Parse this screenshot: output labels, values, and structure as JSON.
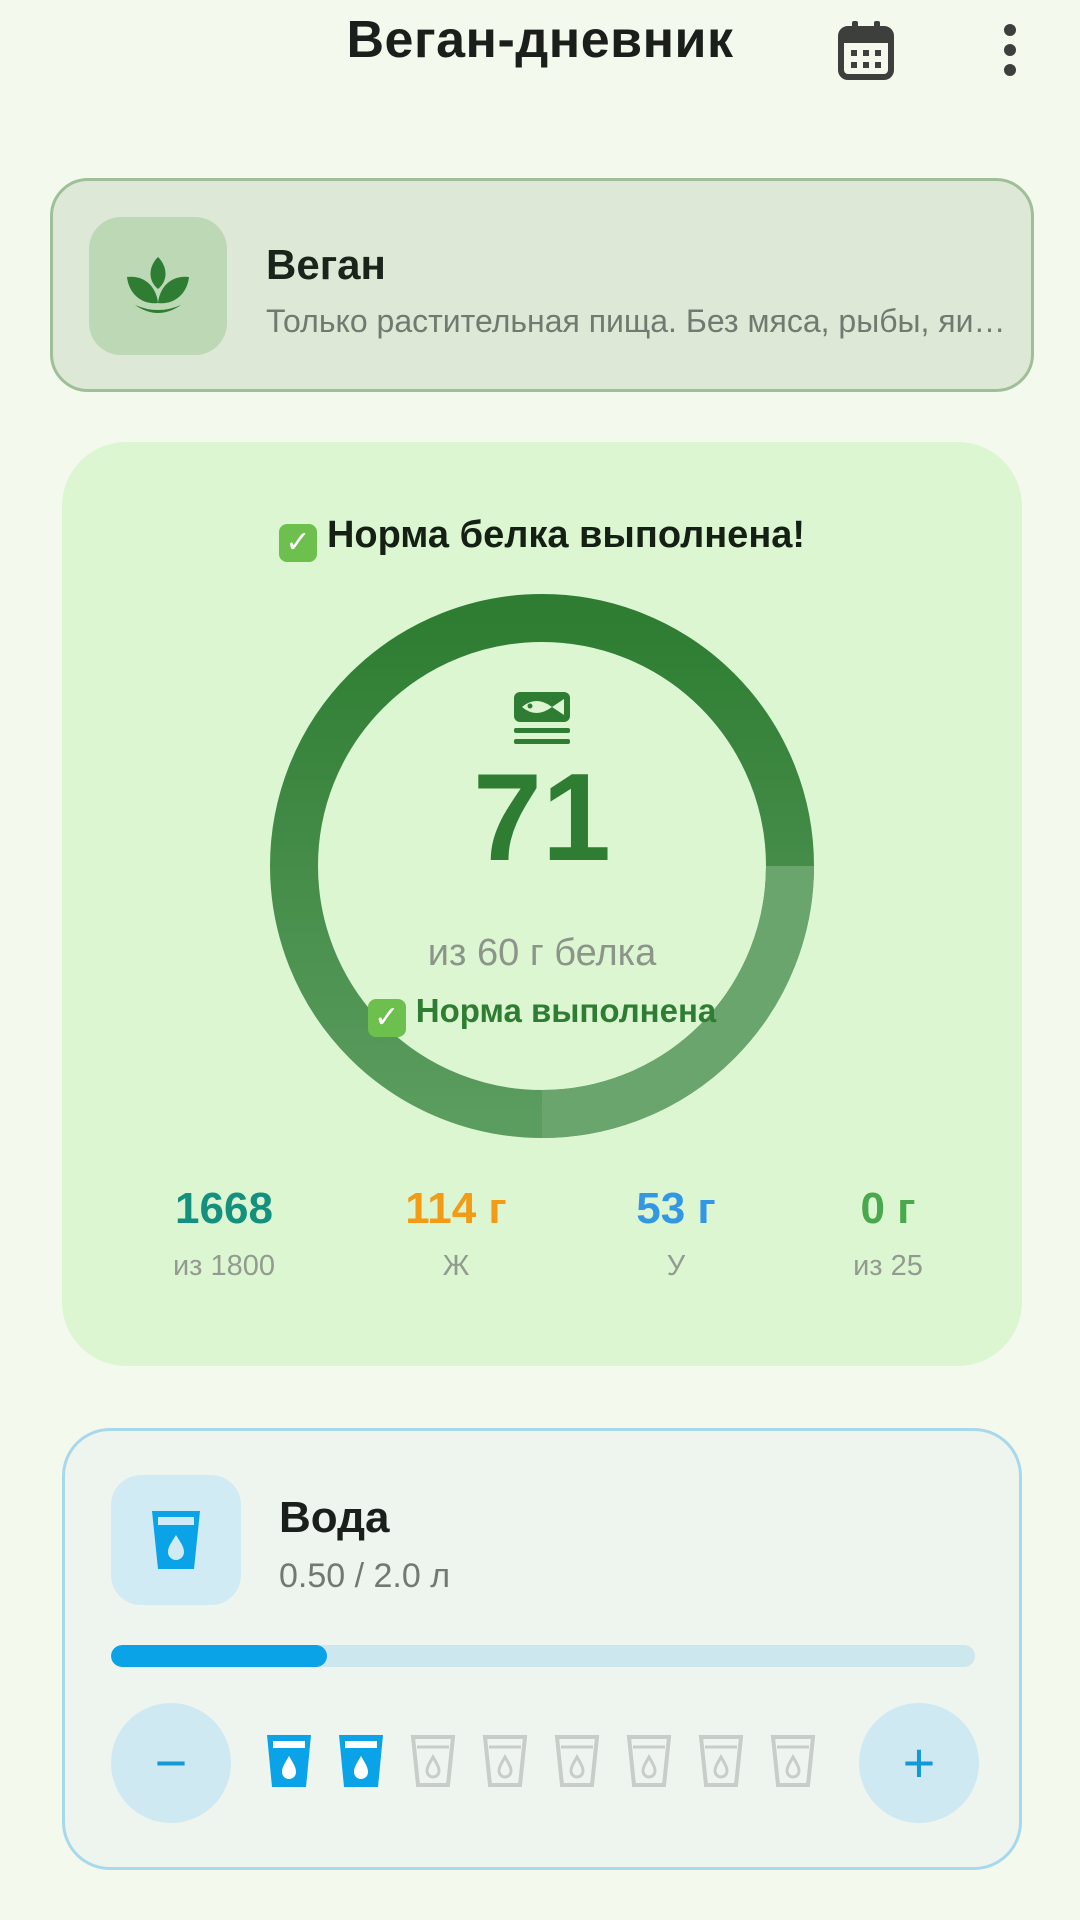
{
  "header": {
    "title": "Веган-дневник",
    "calendar_icon": "calendar-icon",
    "more_icon": "more-vert-icon"
  },
  "diet": {
    "icon": "plant-icon",
    "title": "Веган",
    "description": "Только растительная пища. Без мяса, рыбы, яиц и молочных продуктов."
  },
  "protein": {
    "heading_emoji": "✅",
    "heading": "Норма белка выполнена!",
    "icon": "fish-icon",
    "value": "71",
    "target_text": "из 60 г белка",
    "status_emoji": "✅",
    "status": "Норма выполнена",
    "progress_fraction": 1.0,
    "colors": {
      "ring": "#2e7d32",
      "ring_light": "#66a36a"
    },
    "stats": [
      {
        "value": "1668",
        "label": "из 1800",
        "color": "#13907e"
      },
      {
        "value": "114 г",
        "label": "Ж",
        "color": "#f29b15"
      },
      {
        "value": "53 г",
        "label": "У",
        "color": "#3497e4"
      },
      {
        "value": "0 г",
        "label": "из 25",
        "color": "#4aa84d"
      }
    ]
  },
  "water": {
    "icon": "water-glass-icon",
    "title": "Вода",
    "amount": "0.50 / 2.0 л",
    "progress_fraction": 0.25,
    "minus_label": "−",
    "plus_label": "+",
    "cups_total": 8,
    "cups_filled": 2,
    "colors": {
      "accent": "#0aa3e8",
      "cup_empty": "#c9cdc9"
    }
  }
}
